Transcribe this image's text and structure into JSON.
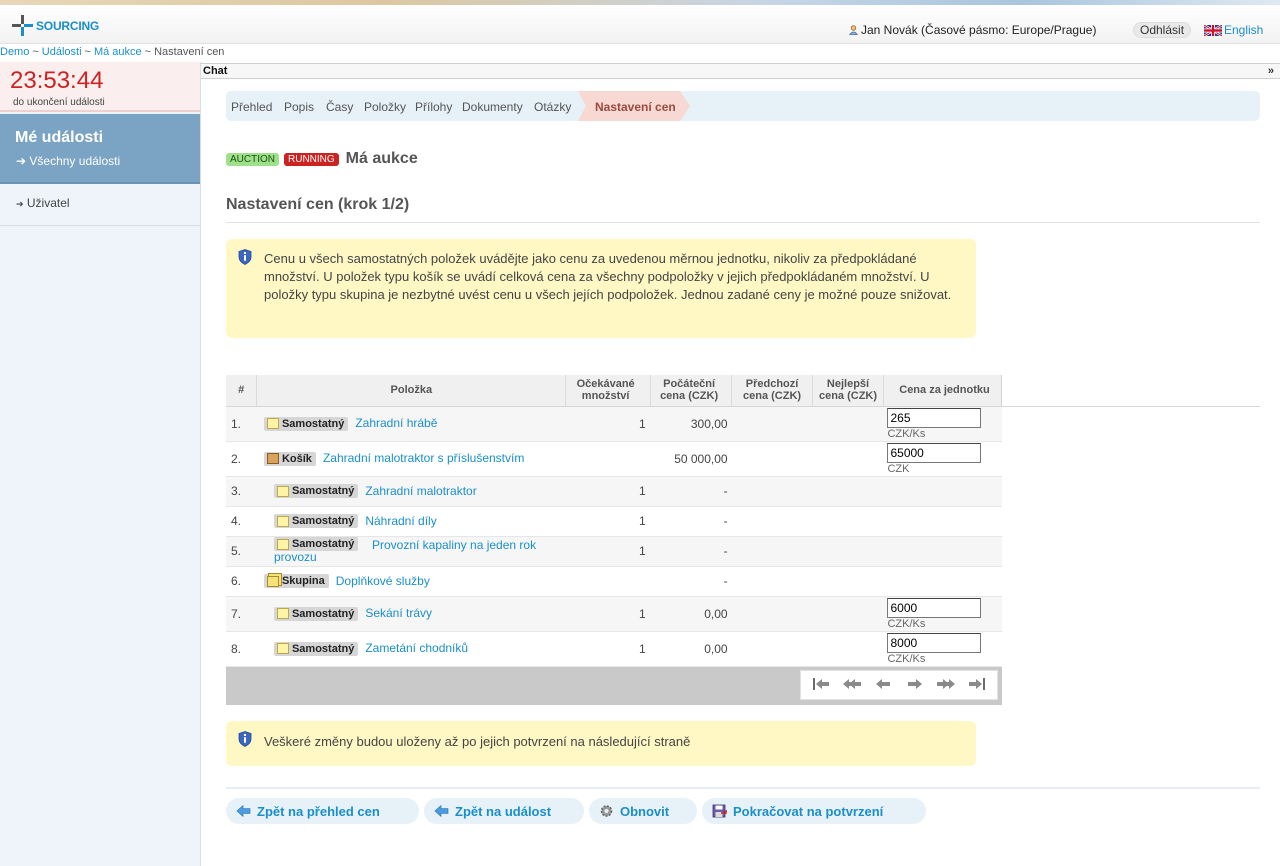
{
  "header": {
    "logo_text": "SOURCING",
    "user": "Jan Novák (Časové pásmo: Europe/Prague)",
    "logout": "Odhlásit",
    "language": "English"
  },
  "breadcrumb": [
    "Demo",
    "Události",
    "Má aukce",
    "Nastavení cen"
  ],
  "sidebar": {
    "timer": "23:53:44",
    "timer_label": "do ukončení události",
    "my_events_title": "Mé události",
    "all_events": "Všechny události",
    "user_item": "Uživatel"
  },
  "chat": {
    "label": "Chat",
    "toggle": "»"
  },
  "tabs": [
    "Přehled",
    "Popis",
    "Časy",
    "Položky",
    "Přílohy",
    "Dokumenty",
    "Otázky"
  ],
  "active_tab": "Nastavení cen",
  "event": {
    "badge_type": "AUCTION",
    "badge_status": "RUNNING",
    "title": "Má aukce"
  },
  "step_title": "Nastavení cen (krok 1/2)",
  "info_top": "Cenu u všech samostatných položek uvádějte jako cenu za uvedenou měrnou jednotku, nikoliv za předpokládané množství. U položek typu košík se uvádí celková cena za všechny podpoložky v jejich předpokládaném množství. U položky typu skupina je nezbytné uvést cenu u všech jejích podpoložek. Jednou zadané ceny je možné pouze snižovat.",
  "table": {
    "headers": [
      "#",
      "Položka",
      "Očekávané množství",
      "Počáteční cena (CZK)",
      "Předchozí cena (CZK)",
      "Nejlepší cena (CZK)",
      "Cena za jednotku"
    ],
    "rows": [
      {
        "num": "1.",
        "type": "Samostatný",
        "name": "Zahradní hrábě",
        "qty": "1",
        "start": "300,00",
        "price": "265",
        "unit": "CZK/Ks"
      },
      {
        "num": "2.",
        "type": "Košík",
        "name": "Zahradní malotraktor s příslušenstvím",
        "qty": "",
        "start": "50 000,00",
        "price": "65000",
        "unit": "CZK"
      },
      {
        "num": "3.",
        "type": "Samostatný",
        "name": "Zahradní malotraktor",
        "qty": "1",
        "start": "-",
        "price": "",
        "unit": ""
      },
      {
        "num": "4.",
        "type": "Samostatný",
        "name": "Náhradní díly",
        "qty": "1",
        "start": "-",
        "price": "",
        "unit": ""
      },
      {
        "num": "5.",
        "type": "Samostatný",
        "name": "Provozní kapaliny na jeden rok provozu",
        "qty": "1",
        "start": "-",
        "price": "",
        "unit": ""
      },
      {
        "num": "6.",
        "type": "Skupina",
        "name": "Doplňkové služby",
        "qty": "",
        "start": "-",
        "price": "",
        "unit": ""
      },
      {
        "num": "7.",
        "type": "Samostatný",
        "name": "Sekání trávy",
        "qty": "1",
        "start": "0,00",
        "price": "6000",
        "unit": "CZK/Ks"
      },
      {
        "num": "8.",
        "type": "Samostatný",
        "name": "Zametání chodníků",
        "qty": "1",
        "start": "0,00",
        "price": "8000",
        "unit": "CZK/Ks"
      }
    ]
  },
  "info_bottom": "Veškeré změny budou uloženy až po jejich potvrzení na následující straně",
  "actions": {
    "back_prices": "Zpět na přehled cen",
    "back_event": "Zpět na událost",
    "refresh": "Obnovit",
    "continue": "Pokračovat na potvrzení"
  },
  "colors": {
    "accent": "#1a8fc7",
    "timer": "#cc2222",
    "running": "#cc2222",
    "auction": "#9fe08a",
    "info_bg": "#fff8c4"
  }
}
